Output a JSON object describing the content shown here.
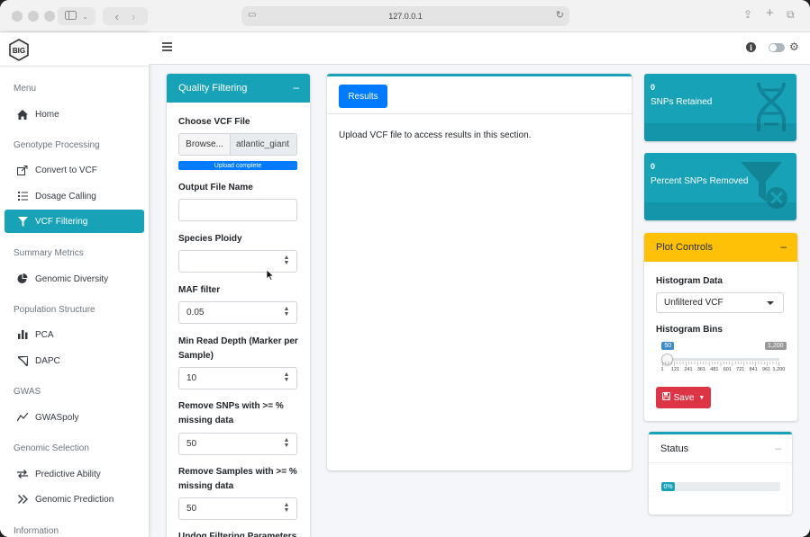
{
  "browser": {
    "url": "127.0.0.1",
    "icons": [
      "sidebar-toggle-icon",
      "chevron-down-icon",
      "back-icon",
      "forward-icon",
      "page-icon",
      "reload-icon",
      "share-icon",
      "new-tab-icon",
      "tabs-overview-icon"
    ]
  },
  "app": {
    "logo_text": "BIG"
  },
  "sidebar": {
    "sections": [
      {
        "heading": "Menu",
        "items": [
          {
            "label": "Home",
            "icon": "home-icon"
          }
        ]
      },
      {
        "heading": "Genotype Processing",
        "items": [
          {
            "label": "Convert to VCF",
            "icon": "convert-icon"
          },
          {
            "label": "Dosage Calling",
            "icon": "list-icon"
          },
          {
            "label": "VCF Filtering",
            "icon": "filter-icon",
            "active": true
          }
        ]
      },
      {
        "heading": "Summary Metrics",
        "items": [
          {
            "label": "Genomic Diversity",
            "icon": "pie-chart-icon"
          }
        ]
      },
      {
        "heading": "Population Structure",
        "items": [
          {
            "label": "PCA",
            "icon": "bar-chart-icon"
          },
          {
            "label": "DAPC",
            "icon": "location-arrow-icon"
          }
        ]
      },
      {
        "heading": "GWAS",
        "items": [
          {
            "label": "GWASpoly",
            "icon": "line-chart-icon"
          }
        ]
      },
      {
        "heading": "Genomic Selection",
        "items": [
          {
            "label": "Predictive Ability",
            "icon": "exchange-icon"
          },
          {
            "label": "Genomic Prediction",
            "icon": "double-chevron-right-icon"
          }
        ]
      },
      {
        "heading": "Information",
        "items": []
      }
    ]
  },
  "quality_filtering": {
    "title": "Quality Filtering",
    "collapse": "–",
    "vcf_label": "Choose VCF File",
    "browse_label": "Browse...",
    "file_name": "atlantic_giant",
    "upload_status": "Upload complete",
    "upload_progress": 1.0,
    "output_label": "Output File Name",
    "output_value": "",
    "ploidy_label": "Species Ploidy",
    "ploidy_value": "",
    "maf_label": "MAF filter",
    "maf_value": "0.05",
    "depth_label": "Min Read Depth (Marker per Sample)",
    "depth_value": "10",
    "snps_missing_label": "Remove SNPs with >= % missing data",
    "snps_missing_value": "50",
    "samples_missing_label": "Remove Samples with >= % missing data",
    "samples_missing_value": "50",
    "updog_label": "Updog Filtering Parameters"
  },
  "results": {
    "tab_label": "Results",
    "message": "Upload VCF file to access results in this section."
  },
  "value_boxes": [
    {
      "value": "0",
      "label": "SNPs Retained",
      "icon": "dna-icon"
    },
    {
      "value": "0",
      "label": "Percent SNPs Removed",
      "icon": "filter-remove-icon"
    }
  ],
  "plot_controls": {
    "title": "Plot Controls",
    "collapse": "–",
    "hist_data_label": "Histogram Data",
    "hist_data_value": "Unfiltered VCF",
    "bins_label": "Histogram Bins",
    "bins_value": "50",
    "bins_max_label": "1,200",
    "bins_min": 1,
    "bins_max": 1200,
    "ticks": [
      "1",
      "121",
      "241",
      "361",
      "481",
      "601",
      "721",
      "841",
      "961",
      "1,200"
    ],
    "save_label": "Save"
  },
  "status": {
    "title": "Status",
    "collapse": "–",
    "progress_text": "0%",
    "progress": 0
  },
  "colors": {
    "info": "#17a2b8",
    "primary": "#007bff",
    "warning": "#ffc107",
    "danger": "#dc3545"
  }
}
